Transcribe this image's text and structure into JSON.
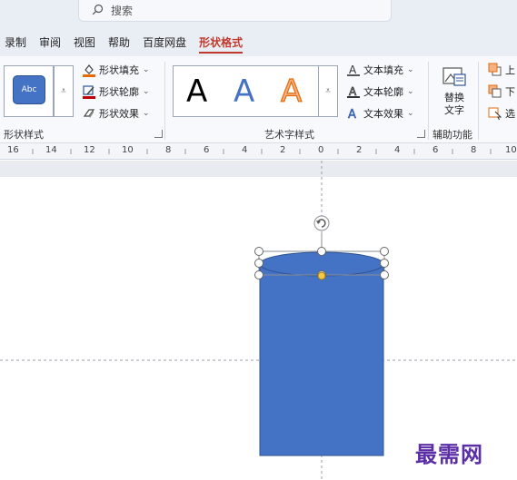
{
  "search": {
    "icon": "search-icon",
    "label": "搜索"
  },
  "tabs": [
    {
      "label": "录制"
    },
    {
      "label": "审阅"
    },
    {
      "label": "视图"
    },
    {
      "label": "帮助"
    },
    {
      "label": "百度网盘"
    },
    {
      "label": "形状格式",
      "active": true
    }
  ],
  "ribbon": {
    "shape_styles": {
      "swatch_label": "Abc",
      "fill": "形状填充",
      "outline": "形状轮廓",
      "effects": "形状效果",
      "group_label": "形状样式",
      "swatch_color": "#4472c4"
    },
    "wordart": {
      "letter": "A",
      "text_fill": "文本填充",
      "text_outline": "文本轮廓",
      "text_effects": "文本效果",
      "group_label": "艺术字样式"
    },
    "accessibility": {
      "alt_text": "替换文字",
      "group_label": "辅助功能"
    },
    "arrange": {
      "bring_forward": "上",
      "send_backward": "下",
      "selection_pane": "选"
    }
  },
  "ruler": {
    "labels": [
      "16",
      "14",
      "12",
      "10",
      "8",
      "6",
      "4",
      "2",
      "0",
      "2",
      "4",
      "6",
      "8",
      "10"
    ]
  },
  "shape": {
    "type": "cylinder",
    "fill": "#4472c4",
    "outline": "#2f528f"
  },
  "watermark": {
    "text": "最需网",
    "color": "#5b2ea6"
  }
}
